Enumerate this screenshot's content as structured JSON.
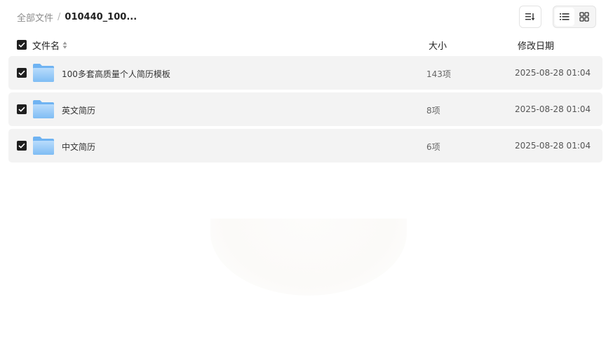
{
  "breadcrumb": {
    "root": "全部文件",
    "separator": "/",
    "current": "010440_100..."
  },
  "toolbar": {
    "sort_icon": "sort-list-icon",
    "view_list_icon": "list-view-icon",
    "view_grid_icon": "grid-view-icon",
    "active_view": "list"
  },
  "columns": {
    "name": "文件名",
    "size": "大小",
    "date": "修改日期"
  },
  "files": [
    {
      "name": "100多套高质量个人简历模板",
      "size": "143项",
      "date": "2025-08-28 01:04",
      "checked": true,
      "icon": "folder-icon"
    },
    {
      "name": "英文简历",
      "size": "8项",
      "date": "2025-08-28 01:04",
      "checked": true,
      "icon": "folder-icon"
    },
    {
      "name": "中文简历",
      "size": "6项",
      "date": "2025-08-28 01:04",
      "checked": true,
      "icon": "folder-icon"
    }
  ],
  "colors": {
    "row_bg": "#f3f3f3",
    "checkbox": "#1f1f1f",
    "folder_light": "#a9d4fb",
    "folder_dark": "#6fb3f2"
  }
}
